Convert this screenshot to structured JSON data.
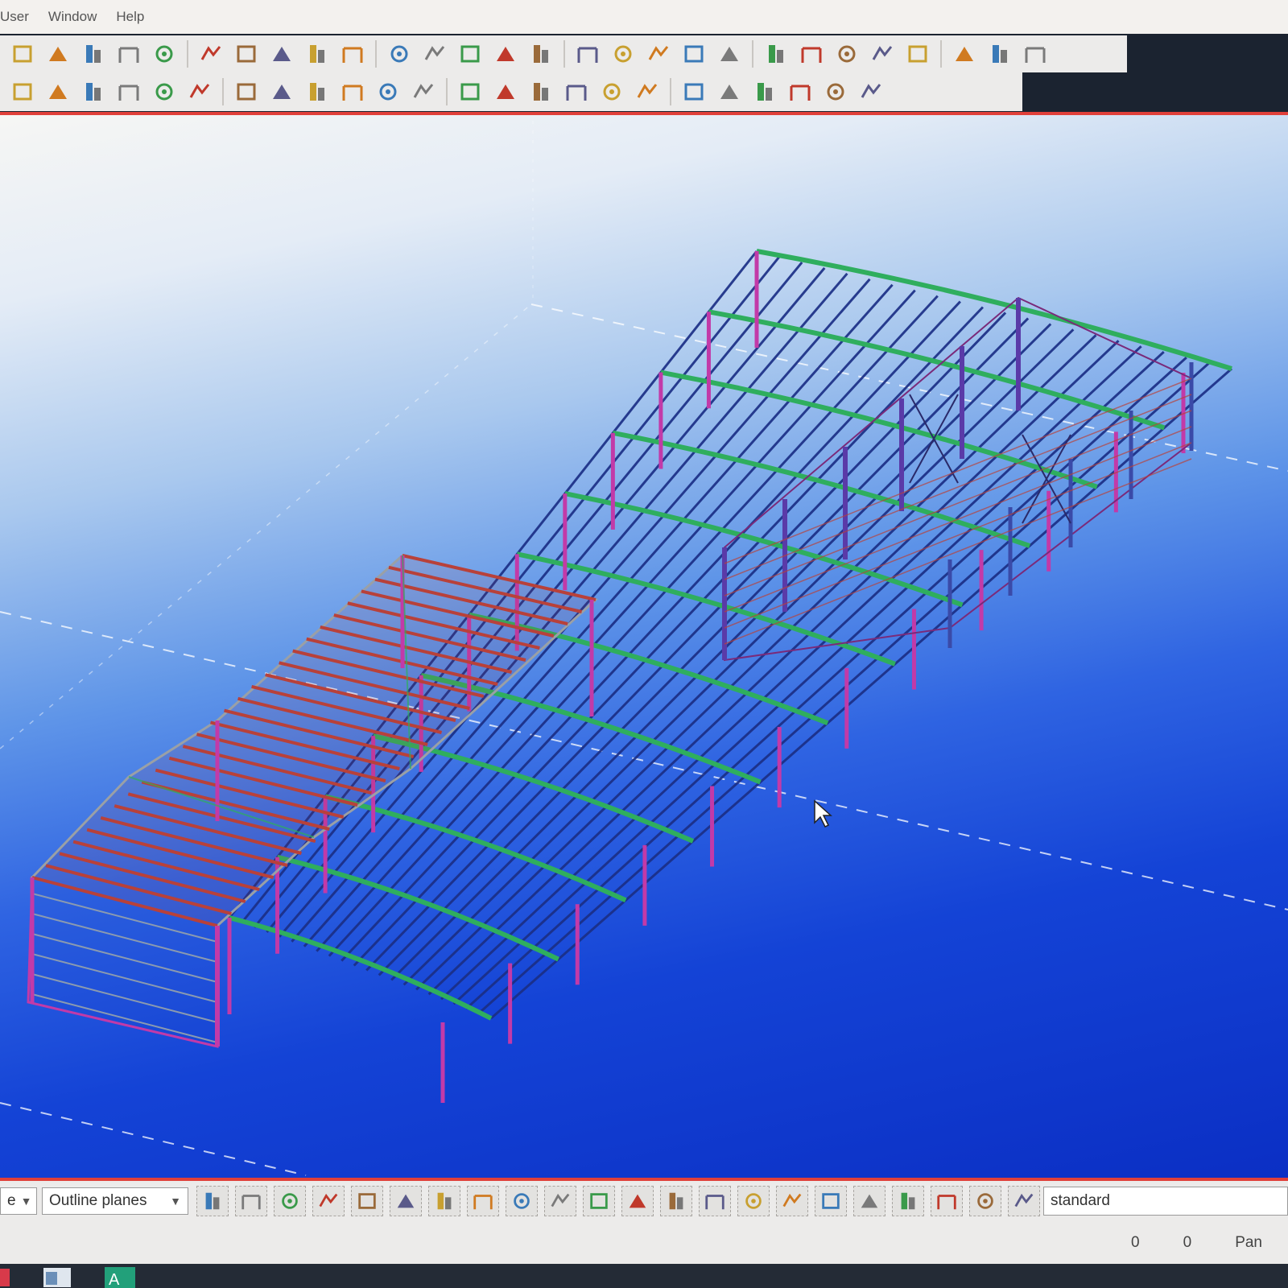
{
  "menubar": {
    "items": [
      "User",
      "Window",
      "Help"
    ]
  },
  "toolbar1": {
    "icons": [
      "view-icon",
      "grid-icon",
      "list-icon",
      "cut-icon",
      "select-icon",
      "xyz-icon",
      "copy-icon",
      "paste-icon",
      "document-icon",
      "move-icon",
      "rotate-icon",
      "mirror-icon",
      "help-icon",
      "gridline-icon",
      "column-icon",
      "angle-icon",
      "measure-icon",
      "arc-icon",
      "frame-icon",
      "pin-icon",
      "layers-icon",
      "zoom-icon",
      "paint-icon",
      "calendar-icon",
      "report-icon",
      "machine-icon",
      "export-icon",
      "print-icon"
    ]
  },
  "toolbar2": {
    "icons": [
      "line-icon",
      "cross-icon",
      "point-icon",
      "dash-line-icon",
      "circle-icon",
      "column-part-icon",
      "beam-part-icon",
      "polybeam-icon",
      "curved-beam-icon",
      "slab-icon",
      "stair-icon",
      "joint-icon",
      "pad-footing-icon",
      "block-icon",
      "panel-icon",
      "column-concrete-icon",
      "beam-concrete-icon",
      "polybeam-concrete-icon",
      "slab-concrete-icon",
      "wall-icon",
      "contour-icon",
      "bolt-icon",
      "weld-icon",
      "rebar-icon"
    ]
  },
  "bottombar": {
    "select_left": "e",
    "select_planes": "Outline planes",
    "icons": [
      "pointer-icon",
      "cone-icon",
      "cube-icon",
      "box-icon",
      "grid-select-icon",
      "line-select-icon",
      "solid-icon",
      "snap-icon",
      "snap-plane-icon",
      "marker-icon",
      "scissors-icon",
      "frame-select-icon",
      "component-icon",
      "part-icon",
      "bolt-select-icon",
      "plane-icon",
      "axis-icon",
      "arrow-down-icon",
      "arrow-up-icon",
      "stack-down-icon",
      "stack-up-icon",
      "phase-icon"
    ],
    "filter_value": "standard"
  },
  "statusbar": {
    "x": "0",
    "y": "0",
    "mode": "Pan"
  },
  "colors": {
    "accent": "#e0403a",
    "column": "#c23aa8",
    "beam": "#2fae5e",
    "purlin": "#1c2f86",
    "steel": "#b8413a"
  }
}
